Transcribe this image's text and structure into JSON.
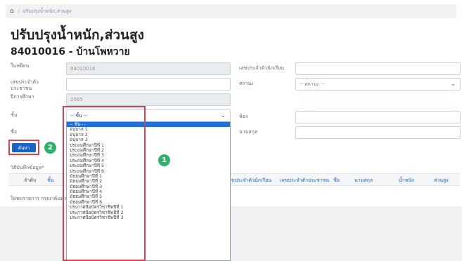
{
  "breadcrumb": {
    "home_icon": "home-icon",
    "items": [
      "ปรับปรุงน้ำหนัก,ส่วนสูง"
    ]
  },
  "page_title": "ปรับปรุงน้ำหนัก,ส่วนสูง",
  "school": "84010016 - บ้านโพหวาย",
  "form": {
    "student_id_label": "ในหยึดน",
    "student_id_value": "84010016",
    "citizen_id_label": "เลขประจำตัวประชาชน",
    "citizen_id_value": "",
    "academic_year_label": "ปีการศึกษา",
    "academic_year_value": "2565",
    "grade_label": "ชั้น",
    "grade_value": "-- ชั้น --",
    "name_label": "ชื่อ",
    "name_value": "",
    "student_no_label": "เลขประจำตัวนักเรียน",
    "student_no_value": "",
    "status_label": "สถานะ",
    "status_value": "-- สถานะ --",
    "room_label": "ห้อง",
    "room_value": "",
    "surname_label": "นามสกุล",
    "surname_value": ""
  },
  "dropdown_options": [
    "-- ชั้น --",
    "อนุบาล 1",
    "อนุบาล 2",
    "อนุบาล 3",
    "ประถมศึกษาปีที่ 1",
    "ประถมศึกษาปีที่ 2",
    "ประถมศึกษาปีที่ 3",
    "ประถมศึกษาปีที่ 4",
    "ประถมศึกษาปีที่ 5",
    "ประถมศึกษาปีที่ 6",
    "มัธยมศึกษาปีที่ 1",
    "มัธยมศึกษาปีที่ 2",
    "มัธยมศึกษาปีที่ 3",
    "มัธยมศึกษาปีที่ 4",
    "มัธยมศึกษาปีที่ 5",
    "มัธยมศึกษาปีที่ 6",
    "ประกาศนียบัตรวิชาชีพปีที่ 1",
    "ประกาศนียบัตรวิชาชีพปีที่ 2",
    "ประกาศนียบัตรวิชาชีพปีที่ 3"
  ],
  "search_button": "ค้นหา",
  "step_badges": [
    "1",
    "2"
  ],
  "table_note": "วิธีบันทึกข้อมูล*",
  "table_headers": [
    "ลำดับ",
    "ชั้น",
    "เลขประจำตัวนักเรียน",
    "เลขประจำตัวประชาชน",
    "ชื่อ",
    "นามสกุล",
    "น้ำหนัก",
    "ส่วนสูง"
  ],
  "empty_message": "ไม่พบรายการ กรุณาค้นหา",
  "colors": {
    "accent": "#1763c7",
    "highlight": "#d9424e",
    "badge": "#2db36a"
  }
}
